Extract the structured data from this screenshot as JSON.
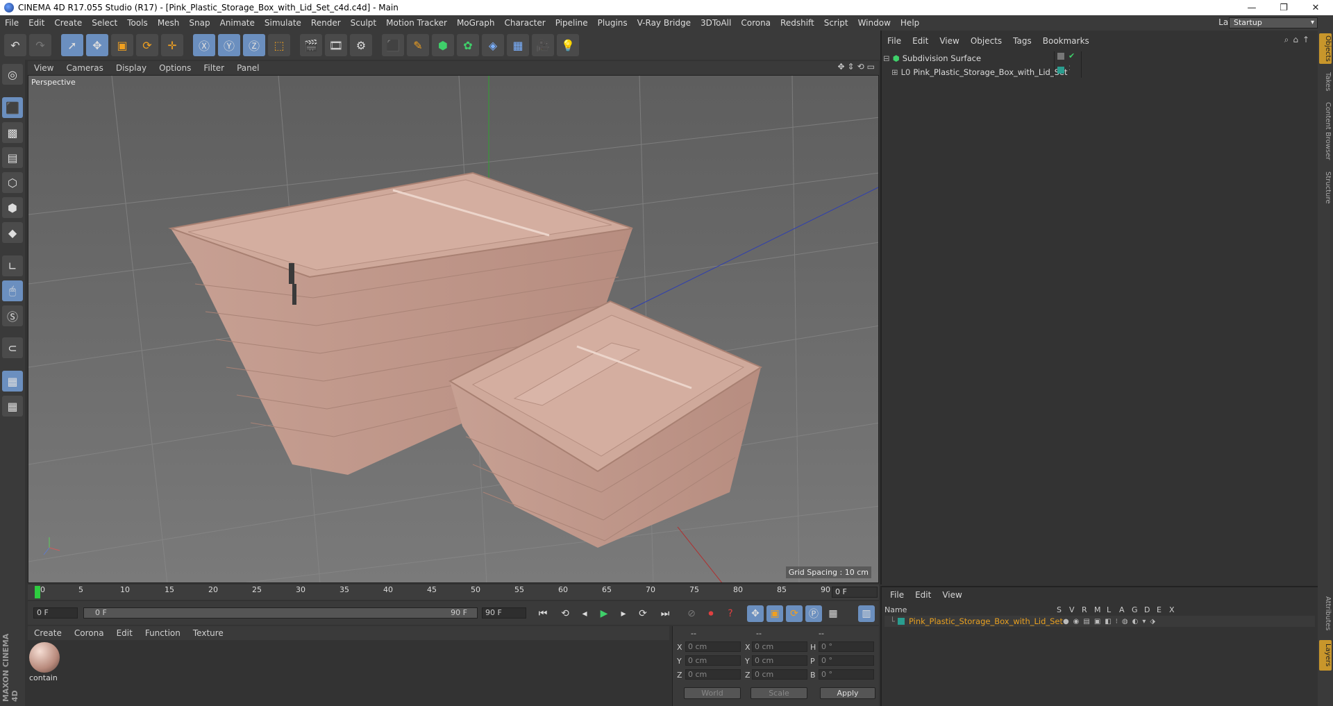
{
  "window": {
    "title": "CINEMA 4D R17.055 Studio (R17) - [Pink_Plastic_Storage_Box_with_Lid_Set_c4d.c4d] - Main",
    "minimize": "—",
    "restore": "❐",
    "close": "✕"
  },
  "menubar": {
    "items": [
      "File",
      "Edit",
      "Create",
      "Select",
      "Tools",
      "Mesh",
      "Snap",
      "Animate",
      "Simulate",
      "Render",
      "Sculpt",
      "Motion Tracker",
      "MoGraph",
      "Character",
      "Pipeline",
      "Plugins",
      "V-Ray Bridge",
      "3DToAll",
      "Corona",
      "Redshift",
      "Script",
      "Window",
      "Help"
    ],
    "layout_label": "Layout:",
    "layout_value": "Startup"
  },
  "viewport": {
    "menu": [
      "View",
      "Cameras",
      "Display",
      "Options",
      "Filter",
      "Panel"
    ],
    "camera_label": "Perspective",
    "grid_spacing": "Grid Spacing : 10 cm",
    "colors": {
      "box": "#c99e90",
      "background": "#6e6e6e"
    }
  },
  "timeline": {
    "ticks": [
      "0",
      "5",
      "10",
      "15",
      "20",
      "25",
      "30",
      "35",
      "40",
      "45",
      "50",
      "55",
      "60",
      "65",
      "70",
      "75",
      "80",
      "85",
      "90"
    ],
    "current_frame": "0 F",
    "start_field": "0 F",
    "range_start": "0 F",
    "range_end": "90 F",
    "end_field": "90 F"
  },
  "material_manager": {
    "menu": [
      "Create",
      "Corona",
      "Edit",
      "Function",
      "Texture"
    ],
    "material_name": "contain"
  },
  "coordinates": {
    "headers": [
      "--",
      "--",
      "--"
    ],
    "rows": [
      {
        "l1": "X",
        "v1": "0 cm",
        "l2": "X",
        "v2": "0 cm",
        "l3": "H",
        "v3": "0 °"
      },
      {
        "l1": "Y",
        "v1": "0 cm",
        "l2": "Y",
        "v2": "0 cm",
        "l3": "P",
        "v3": "0 °"
      },
      {
        "l1": "Z",
        "v1": "0 cm",
        "l2": "Z",
        "v2": "0 cm",
        "l3": "B",
        "v3": "0 °"
      }
    ],
    "world": "World",
    "scale": "Scale",
    "apply": "Apply"
  },
  "object_manager": {
    "menu": [
      "File",
      "Edit",
      "View",
      "Objects",
      "Tags",
      "Bookmarks"
    ],
    "objects": [
      "Subdivision Surface",
      "Pink_Plastic_Storage_Box_with_Lid_Set"
    ]
  },
  "layer_manager": {
    "menu": [
      "File",
      "Edit",
      "View"
    ],
    "columns": [
      "Name",
      "S",
      "V",
      "R",
      "M",
      "L",
      "A",
      "G",
      "D",
      "E",
      "X"
    ],
    "layer": "Pink_Plastic_Storage_Box_with_Lid_Set",
    "layer_color": "#e8a020"
  },
  "right_tabs": [
    "Objects",
    "Takes",
    "Content Browser",
    "Structure",
    "Attributes",
    "Layers"
  ],
  "branding": "MAXON CINEMA 4D"
}
